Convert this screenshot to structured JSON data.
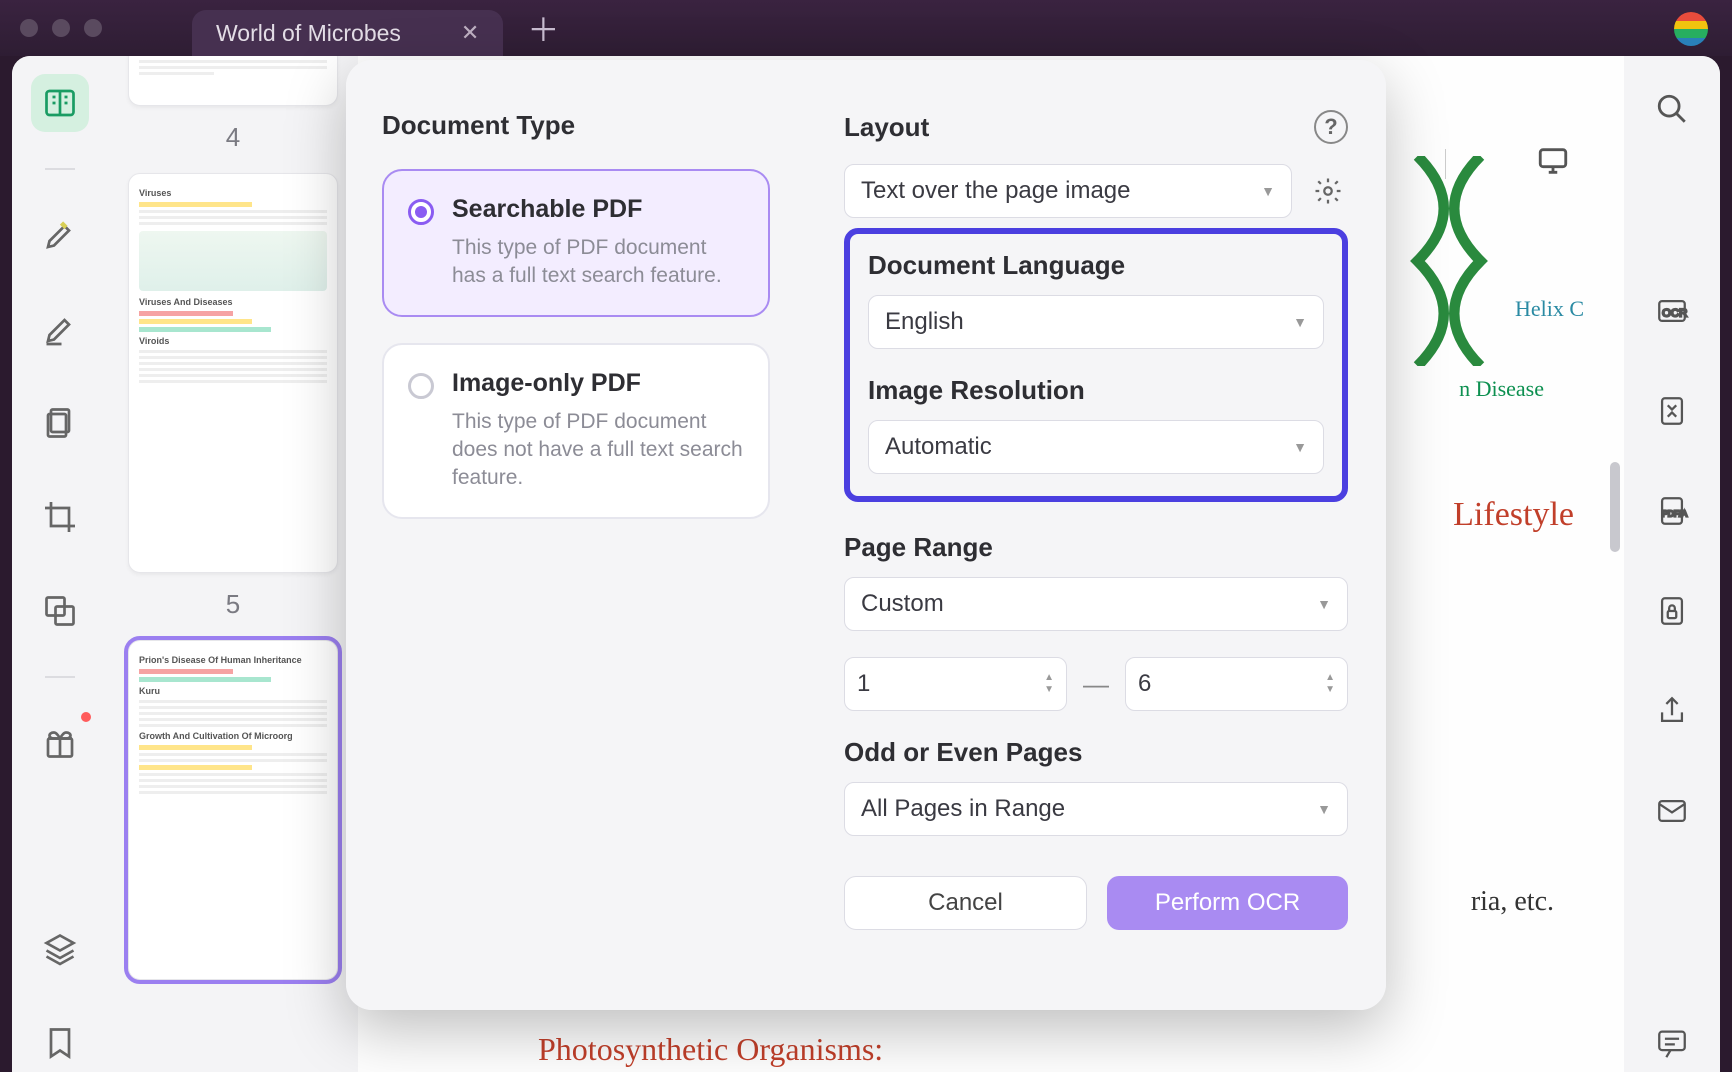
{
  "titlebar": {
    "tab_title": "World of Microbes"
  },
  "thumbnails": {
    "pages": [
      "4",
      "5"
    ],
    "snippet_headings": [
      "Viruses",
      "Viruses And Diseases",
      "Viroids",
      "Prion's Disease Of Human Inheritance",
      "Kuru",
      "Growth And Cultivation Of Microorg"
    ]
  },
  "content": {
    "helix_label": "Helix C",
    "disease_label": "n Disease",
    "lifestyle_label": "Lifestyle",
    "ria_label": "ria, etc.",
    "footer_label": "Photosynthetic Organisms:"
  },
  "dialog": {
    "doc_type_title": "Document Type",
    "searchable": {
      "title": "Searchable PDF",
      "desc": "This type of PDF document has a full text search feature."
    },
    "image_only": {
      "title": "Image-only PDF",
      "desc": "This type of PDF document does not have a full text search feature."
    },
    "layout_title": "Layout",
    "layout_value": "Text over the page image",
    "lang_title": "Document Language",
    "lang_value": "English",
    "res_title": "Image Resolution",
    "res_value": "Automatic",
    "range_title": "Page Range",
    "range_value": "Custom",
    "range_from": "1",
    "range_to": "6",
    "odd_title": "Odd or Even Pages",
    "odd_value": "All Pages in Range",
    "cancel": "Cancel",
    "perform": "Perform OCR"
  },
  "right_rail": {
    "items": [
      "OCR",
      "PDF/A"
    ]
  }
}
